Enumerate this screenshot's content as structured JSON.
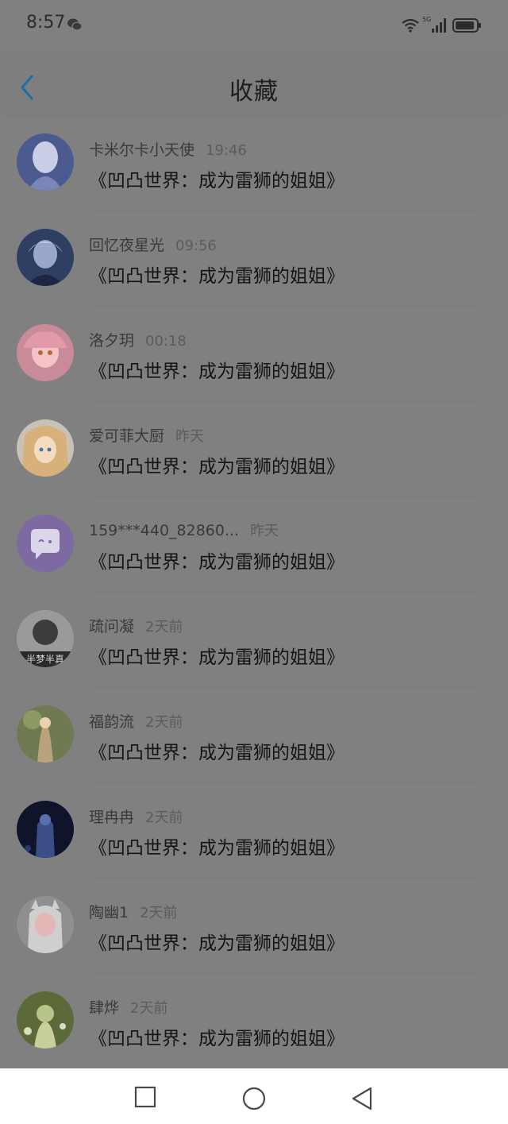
{
  "status_bar": {
    "time": "8:57",
    "network": "5G"
  },
  "header": {
    "title": "收藏"
  },
  "items": [
    {
      "name": "卡米尔卡小天使",
      "time": "19:46",
      "title": "《凹凸世界：成为雷狮的姐姐》",
      "avatar_colors": [
        "#4b5a8f",
        "#c9cde8"
      ]
    },
    {
      "name": "回忆夜星光",
      "time": "09:56",
      "title": "《凹凸世界：成为雷狮的姐姐》",
      "avatar_colors": [
        "#2e3f63",
        "#9aa7cc"
      ]
    },
    {
      "name": "洛夕玥",
      "time": "00:18",
      "title": "《凹凸世界：成为雷狮的姐姐》",
      "avatar_colors": [
        "#c98a9a",
        "#f3c3c8"
      ]
    },
    {
      "name": "爱可菲大厨",
      "time": "昨天",
      "title": "《凹凸世界：成为雷狮的姐姐》",
      "avatar_colors": [
        "#d7b07a",
        "#f4dcc0"
      ]
    },
    {
      "name": "159***440_82860...",
      "time": "昨天",
      "title": "《凹凸世界：成为雷狮的姐姐》",
      "avatar_colors": [
        "#7d6aa2",
        "#9a86c2"
      ]
    },
    {
      "name": "疏问凝",
      "time": "2天前",
      "title": "《凹凸世界：成为雷狮的姐姐》",
      "avatar_colors": [
        "#3c3c3c",
        "#9a9a9a"
      ],
      "avatar_text": "半梦半真"
    },
    {
      "name": "福韵流",
      "time": "2天前",
      "title": "《凹凸世界：成为雷狮的姐姐》",
      "avatar_colors": [
        "#6f7a52",
        "#b8a37a"
      ]
    },
    {
      "name": "理冉冉",
      "time": "2天前",
      "title": "《凹凸世界：成为雷狮的姐姐》",
      "avatar_colors": [
        "#10142a",
        "#3c4e86"
      ]
    },
    {
      "name": "陶幽1",
      "time": "2天前",
      "title": "《凹凸世界：成为雷狮的姐姐》",
      "avatar_colors": [
        "#8f8f8f",
        "#e4b7b7"
      ]
    },
    {
      "name": "肆烨",
      "time": "2天前",
      "title": "《凹凸世界：成为雷狮的姐姐》",
      "avatar_colors": [
        "#5c6a3a",
        "#b9c48a"
      ]
    }
  ],
  "icons": {
    "back": "chevron-left-icon",
    "wechat": "wechat-icon",
    "wifi": "wifi-icon",
    "signal": "signal-icon",
    "battery": "battery-icon",
    "nav_recent": "square-icon",
    "nav_home": "circle-icon",
    "nav_back": "triangle-icon"
  },
  "colors": {
    "accent": "#1d6fa8",
    "scrim": "#808080",
    "nav_bg": "#ffffff"
  }
}
